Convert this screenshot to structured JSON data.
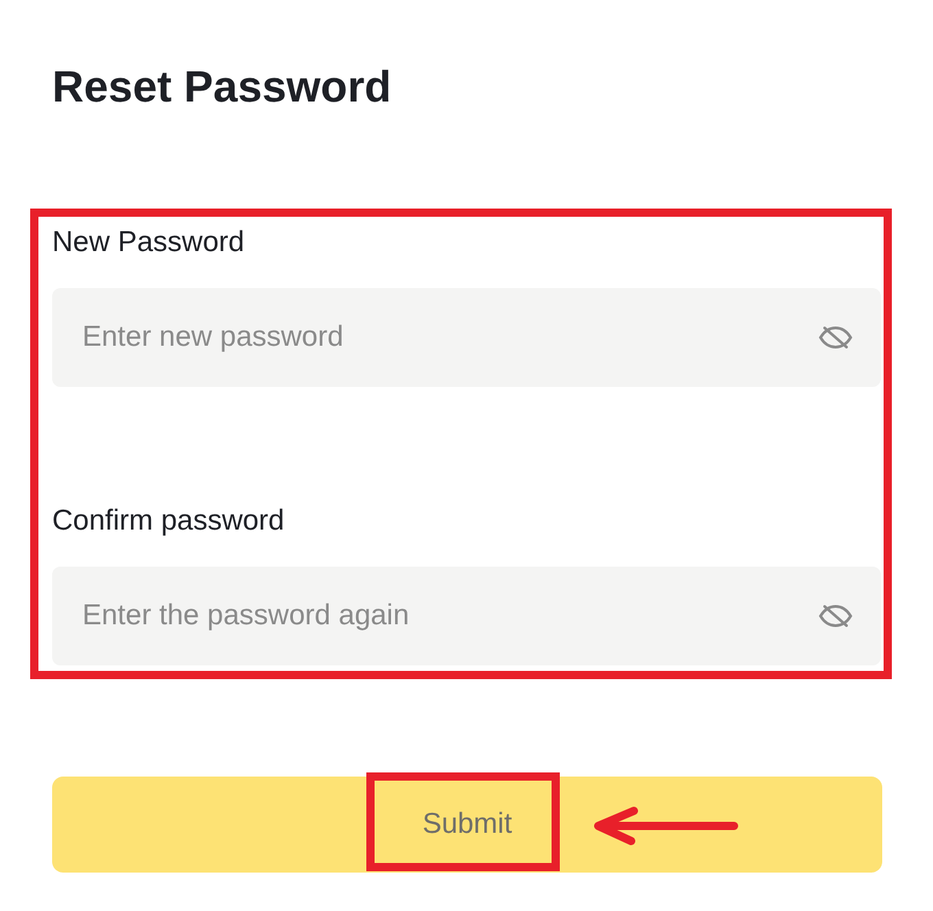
{
  "title": "Reset Password",
  "fields": [
    {
      "label": "New Password",
      "placeholder": "Enter new password"
    },
    {
      "label": "Confirm password",
      "placeholder": "Enter the password again"
    }
  ],
  "submit_button": {
    "label": "Submit"
  }
}
